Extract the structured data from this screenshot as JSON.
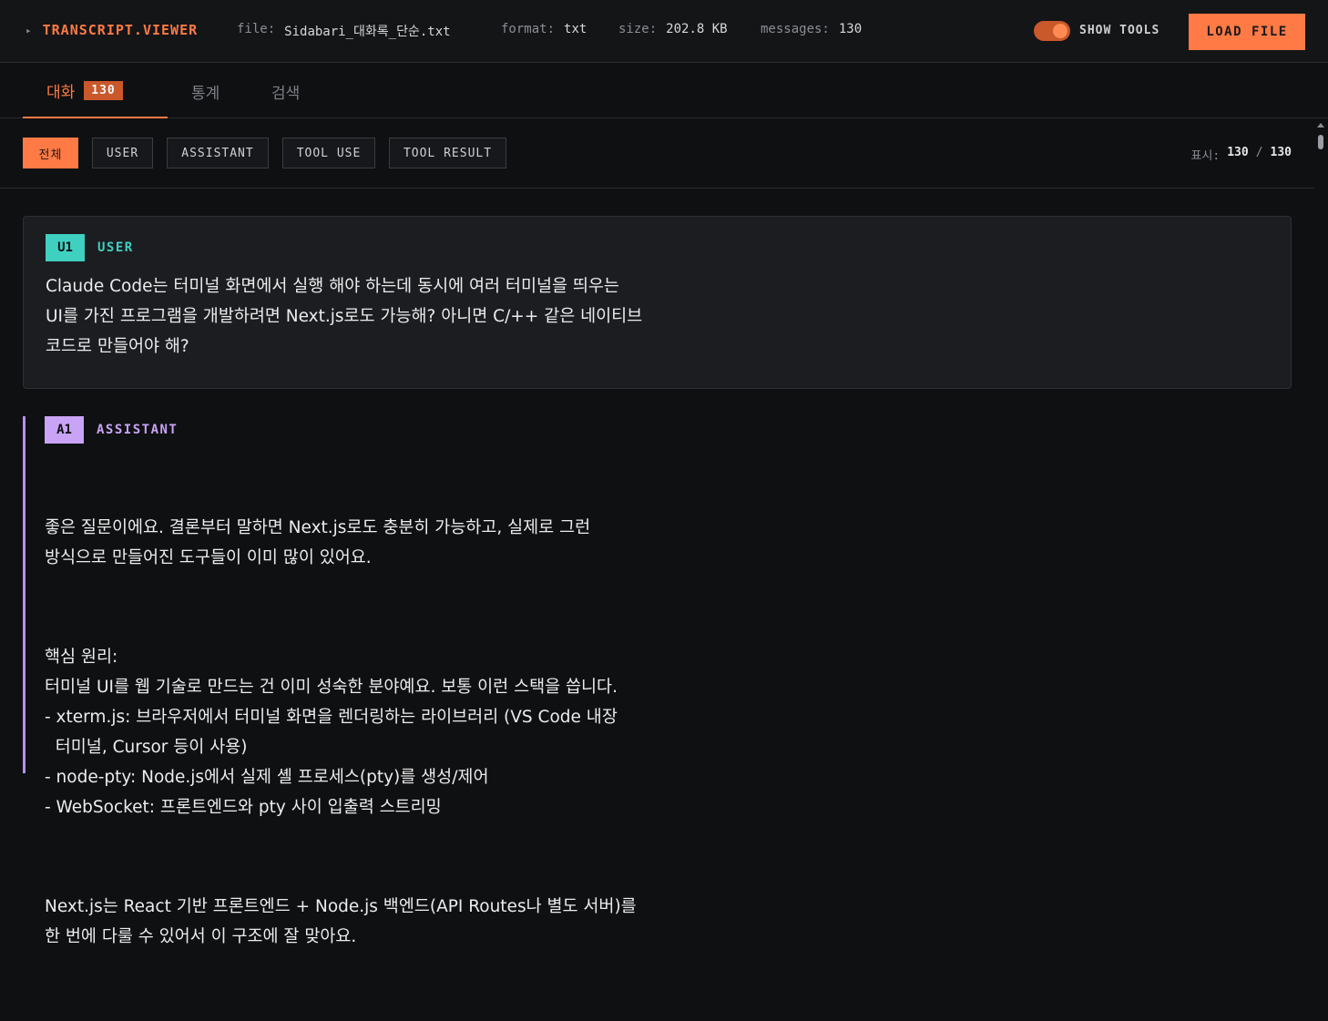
{
  "header": {
    "brand": "TRANSCRIPT.VIEWER",
    "file_label": "file:",
    "file_value": "Sidabari_대화록_단순.txt",
    "format_label": "format:",
    "format_value": "txt",
    "size_label": "size:",
    "size_value": "202.8 KB",
    "messages_label": "messages:",
    "messages_value": "130",
    "show_tools_label": "SHOW TOOLS",
    "show_tools_on": true,
    "load_button": "LOAD FILE"
  },
  "tabs": [
    {
      "label": "대화",
      "badge": "130",
      "active": true
    },
    {
      "label": "통계",
      "active": false
    },
    {
      "label": "검색",
      "active": false
    }
  ],
  "filters": [
    {
      "label": "전체",
      "active": true
    },
    {
      "label": "USER",
      "active": false
    },
    {
      "label": "ASSISTANT",
      "active": false
    },
    {
      "label": "TOOL USE",
      "active": false
    },
    {
      "label": "TOOL RESULT",
      "active": false
    }
  ],
  "display_count": {
    "label": "표시:",
    "shown": "130",
    "separator": "/",
    "total": "130"
  },
  "messages": [
    {
      "badge": "U1",
      "role": "USER",
      "text": "Claude Code는 터미널 화면에서 실행 해야 하는데 동시에 여러 터미널을 띄우는\nUI를 가진 프로그램을 개발하려면 Next.js로도 가능해? 아니면 C/++ 같은 네이티브\n코드로 만들어야 해?"
    },
    {
      "badge": "A1",
      "role": "ASSISTANT",
      "paragraphs": [
        "좋은 질문이에요. 결론부터 말하면 Next.js로도 충분히 가능하고, 실제로 그런\n방식으로 만들어진 도구들이 이미 많이 있어요.",
        "핵심 원리:\n터미널 UI를 웹 기술로 만드는 건 이미 성숙한 분야예요. 보통 이런 스택을 씁니다.\n- xterm.js: 브라우저에서 터미널 화면을 렌더링하는 라이브러리 (VS Code 내장\n  터미널, Cursor 등이 사용)\n- node-pty: Node.js에서 실제 셸 프로세스(pty)를 생성/제어\n- WebSocket: 프론트엔드와 pty 사이 입출력 스트리밍",
        "Next.js는 React 기반 프론트엔드 + Node.js 백엔드(API Routes나 별도 서버)를\n한 번에 다룰 수 있어서 이 구조에 잘 맞아요."
      ]
    }
  ],
  "colors": {
    "accent": "#ff7a45",
    "user": "#3fd0c0",
    "assistant": "#c9a3f5",
    "background": "#0f1012"
  }
}
